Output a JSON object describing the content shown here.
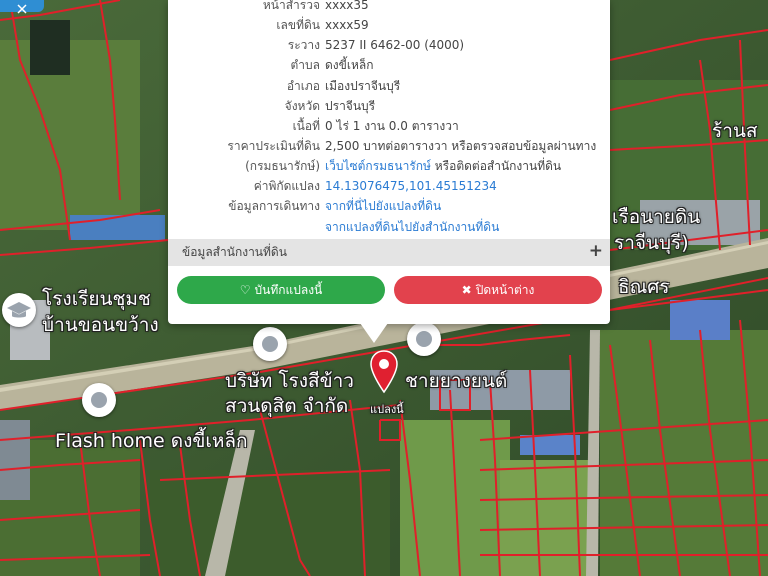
{
  "popup": {
    "rows": [
      {
        "key": "หน้าสำรวจ",
        "value": "xxxx35"
      },
      {
        "key": "เลขที่ดิน",
        "value": "xxxx59"
      },
      {
        "key": "ระวาง",
        "value": "5237 II 6462-00 (4000)"
      },
      {
        "key": "ตำบล",
        "value": "ดงขี้เหล็ก"
      },
      {
        "key": "อำเภอ",
        "value": "เมืองปราจีนบุรี"
      },
      {
        "key": "จังหวัด",
        "value": "ปราจีนบุรี"
      },
      {
        "key": "เนื้อที่",
        "value": "0 ไร่ 1 งาน 0.0 ตารางวา"
      },
      {
        "key": "ราคาประเมินที่ดิน",
        "value": "2,500 บาทต่อตารางวา หรือตรวจสอบข้อมูลผ่านทาง"
      },
      {
        "key": "(กรมธนารักษ์)",
        "value_link": "เว็บไซต์กรมธนารักษ์",
        "value_rest": " หรือติดต่อสำนักงานที่ดิน"
      },
      {
        "key": "ค่าพิกัดแปลง",
        "value": "14.13076475,101.45151234"
      },
      {
        "key": "ข้อมูลการเดินทาง",
        "value": "จากที่นี่ไปยังแปลงที่ดิน"
      },
      {
        "key": "",
        "value": "จากแปลงที่ดินไปยังสำนักงานที่ดิน"
      }
    ],
    "office_section": {
      "label": "ข้อมูลสำนักงานที่ดิน",
      "toggle": "+"
    },
    "save_button": {
      "icon": "♡",
      "label": "บันทึกแปลงนี้"
    },
    "close_button": {
      "icon": "✖",
      "label": "ปิดหน้าต่าง"
    }
  },
  "map_labels": {
    "school_line1": "โรงเรียนชุมช",
    "school_line2": "บ้านขอนขว้าง",
    "company_line1": "บริษัท โรงสีข้าว",
    "company_line1b": "ชายยางยนต์",
    "company_line2": "สวนดุสิต จำกัด",
    "flash_home": "Flash home ดงขี้เหล็ก",
    "road_right": "ธิณศร",
    "shop_right": "ร้านส",
    "place_right1": "เรือนายดิน",
    "place_right2": "ราจีนบุรี)",
    "marker_label": "แปลงนี้"
  },
  "colors": {
    "parcel_line": "#e0202a",
    "link": "#2a7bd3",
    "save": "#2ea84a",
    "close": "#e2424d"
  }
}
